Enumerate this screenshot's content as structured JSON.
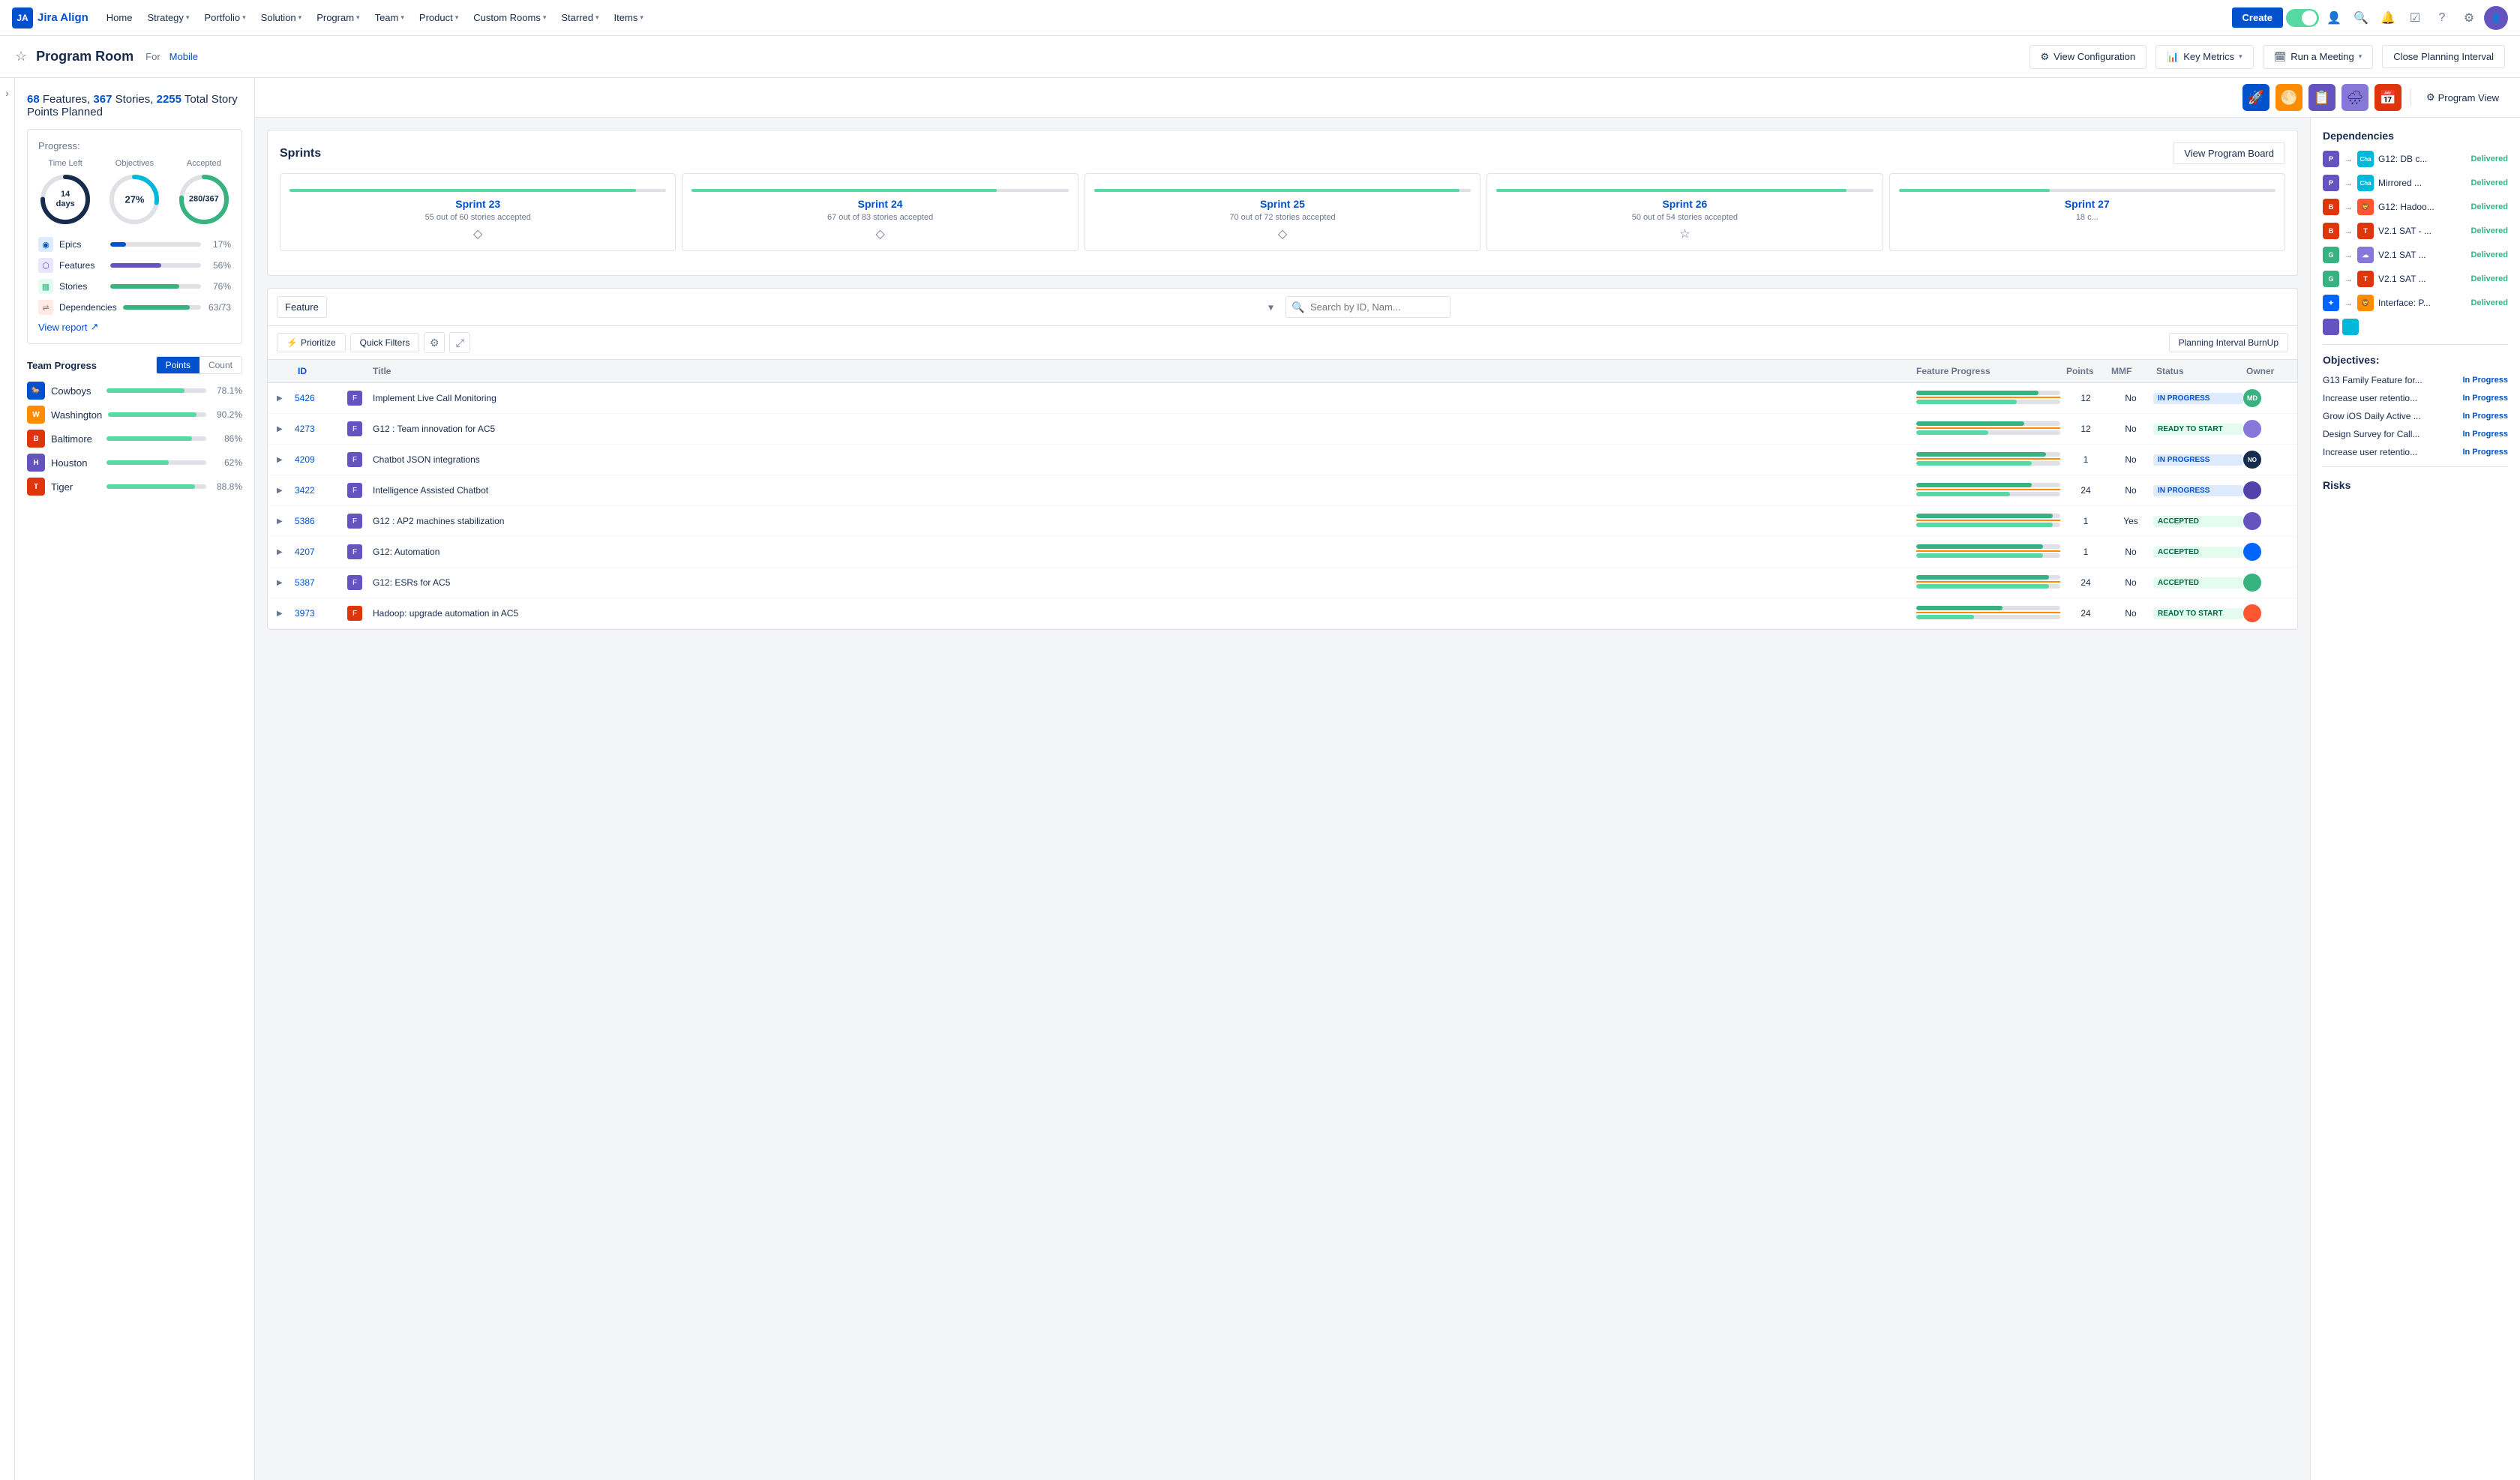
{
  "app": {
    "name": "Jira Align",
    "logo_text": "JA"
  },
  "nav": {
    "items": [
      {
        "label": "Home",
        "has_dropdown": false
      },
      {
        "label": "Strategy",
        "has_dropdown": true
      },
      {
        "label": "Portfolio",
        "has_dropdown": true
      },
      {
        "label": "Solution",
        "has_dropdown": true
      },
      {
        "label": "Program",
        "has_dropdown": true
      },
      {
        "label": "Team",
        "has_dropdown": true
      },
      {
        "label": "Product",
        "has_dropdown": true
      },
      {
        "label": "Custom Rooms",
        "has_dropdown": true
      },
      {
        "label": "Starred",
        "has_dropdown": true
      },
      {
        "label": "Items",
        "has_dropdown": true
      }
    ],
    "create_label": "Create"
  },
  "subheader": {
    "title": "Program Room",
    "for_label": "For",
    "room_name": "Mobile",
    "view_config_label": "View Configuration",
    "key_metrics_label": "Key Metrics",
    "run_meeting_label": "Run a Meeting",
    "close_interval_label": "Close Planning Interval",
    "program_view_label": "Program View"
  },
  "stats_header": {
    "features_count": "68",
    "stories_count": "367",
    "points_total": "2255",
    "label": "Features,",
    "label2": "Stories,",
    "label3": "Total Story Points Planned"
  },
  "progress": {
    "label": "Progress:",
    "time_left_label": "Time Left",
    "objectives_label": "Objectives",
    "accepted_label": "Accepted",
    "time_left_value": "14 days",
    "objectives_value": "27%",
    "objectives_pct": 27,
    "accepted_value": "280/367",
    "accepted_pct": 76,
    "bars": [
      {
        "icon": "◉",
        "icon_color": "#0052cc",
        "icon_bg": "#deebff",
        "label": "Epics",
        "pct": 17,
        "color": "#0052cc"
      },
      {
        "icon": "⬡",
        "icon_color": "#6554c0",
        "icon_bg": "#eae6ff",
        "label": "Features",
        "pct": 56,
        "color": "#6554c0"
      },
      {
        "icon": "▦",
        "icon_color": "#36b37e",
        "icon_bg": "#e3fcef",
        "label": "Stories",
        "pct": 76,
        "color": "#36b37e"
      },
      {
        "icon": "⇌",
        "icon_color": "#ff5630",
        "icon_bg": "#ffebe6",
        "label": "Dependencies",
        "pct": 86,
        "color": "#36b37e",
        "count": "63/73"
      }
    ],
    "view_report_label": "View report"
  },
  "team_progress": {
    "title": "Team Progress",
    "tabs": [
      "Points",
      "Count"
    ],
    "active_tab": "Points",
    "teams": [
      {
        "name": "Cowboys",
        "pct": 78.1,
        "pct_label": "78.1%",
        "color": "#0052cc",
        "icon_bg": "#0052cc",
        "icon_text": "🐎"
      },
      {
        "name": "Washington",
        "pct": 90.2,
        "pct_label": "90.2%",
        "color": "#36b37e",
        "icon_bg": "#ff8b00",
        "icon_text": "W"
      },
      {
        "name": "Baltimore",
        "pct": 86,
        "pct_label": "86%",
        "color": "#36b37e",
        "icon_bg": "#de350b",
        "icon_text": "B"
      },
      {
        "name": "Houston",
        "pct": 62,
        "pct_label": "62%",
        "color": "#36b37e",
        "icon_bg": "#6554c0",
        "icon_text": "H"
      },
      {
        "name": "Tiger",
        "pct": 88.8,
        "pct_label": "88.8%",
        "color": "#36b37e",
        "icon_bg": "#de350b",
        "icon_text": "T"
      }
    ]
  },
  "sprints": {
    "title": "Sprints",
    "view_board_label": "View Program Board",
    "items": [
      {
        "name": "Sprint 23",
        "stories": "55 out of 60 stories accepted",
        "pct": 92
      },
      {
        "name": "Sprint 24",
        "stories": "67 out of 83 stories accepted",
        "pct": 81
      },
      {
        "name": "Sprint 25",
        "stories": "70 out of 72 stories accepted",
        "pct": 97
      },
      {
        "name": "Sprint 26",
        "stories": "50 out of 54 stories accepted",
        "pct": 93
      },
      {
        "name": "Sprint 27",
        "stories": "18 c...",
        "pct": 40
      }
    ]
  },
  "feature_table": {
    "select_placeholder": "Feature",
    "search_placeholder": "Search by ID, Nam...",
    "prioritize_label": "Prioritize",
    "quick_filters_label": "Quick Filters",
    "burnup_label": "Planning Interval BurnUp",
    "columns": [
      "",
      "ID",
      "",
      "Title",
      "Feature Progress",
      "Points",
      "MMF",
      "Status",
      "Owner"
    ],
    "rows": [
      {
        "expand": "▶",
        "id": "5426",
        "icon_bg": "#6554c0",
        "icon_text": "F",
        "title": "Implement Live Call Monitoring",
        "progress": 85,
        "points": 12,
        "mmf": "No",
        "status": "IN PROGRESS",
        "status_class": "status-in-progress",
        "avatar_bg": "#36b37e",
        "avatar_text": "MD"
      },
      {
        "expand": "▶",
        "id": "4273",
        "icon_bg": "#6554c0",
        "icon_text": "F",
        "title": "G12 : Team innovation for AC5",
        "progress": 75,
        "points": 12,
        "mmf": "No",
        "status": "READY TO START",
        "status_class": "status-ready",
        "avatar_bg": "#8777d9",
        "avatar_text": ""
      },
      {
        "expand": "▶",
        "id": "4209",
        "icon_bg": "#6554c0",
        "icon_text": "F",
        "title": "Chatbot JSON integrations",
        "progress": 90,
        "points": 1,
        "mmf": "No",
        "status": "IN PROGRESS",
        "status_class": "status-in-progress",
        "avatar_bg": "#172b4d",
        "avatar_text": "NO"
      },
      {
        "expand": "▶",
        "id": "3422",
        "icon_bg": "#6554c0",
        "icon_text": "F",
        "title": "Intelligence Assisted Chatbot",
        "progress": 80,
        "points": 24,
        "mmf": "No",
        "status": "IN PROGRESS",
        "status_class": "status-in-progress",
        "avatar_bg": "#5243aa",
        "avatar_text": ""
      },
      {
        "expand": "▶",
        "id": "5386",
        "icon_bg": "#6554c0",
        "icon_text": "F",
        "title": "G12 : AP2 machines stabilization",
        "progress": 95,
        "points": 1,
        "mmf": "Yes",
        "status": "ACCEPTED",
        "status_class": "status-accepted",
        "avatar_bg": "#6554c0",
        "avatar_text": ""
      },
      {
        "expand": "▶",
        "id": "4207",
        "icon_bg": "#6554c0",
        "icon_text": "F",
        "title": "G12: Automation",
        "progress": 88,
        "points": 1,
        "mmf": "No",
        "status": "ACCEPTED",
        "status_class": "status-accepted",
        "avatar_bg": "#0065ff",
        "avatar_text": ""
      },
      {
        "expand": "▶",
        "id": "5387",
        "icon_bg": "#6554c0",
        "icon_text": "F",
        "title": "G12: ESRs for AC5",
        "progress": 92,
        "points": 24,
        "mmf": "No",
        "status": "ACCEPTED",
        "status_class": "status-accepted",
        "avatar_bg": "#36b37e",
        "avatar_text": ""
      },
      {
        "expand": "▶",
        "id": "3973",
        "icon_bg": "#de350b",
        "icon_text": "F",
        "title": "Hadoop: upgrade automation in AC5",
        "progress": 60,
        "points": 24,
        "mmf": "No",
        "status": "READY TO START",
        "status_class": "status-ready",
        "avatar_bg": "#ff5630",
        "avatar_text": ""
      }
    ]
  },
  "dependencies_panel": {
    "title": "Dependencies",
    "items": [
      {
        "from_bg": "#6554c0",
        "from_text": "P",
        "to_bg": "#00b8d9",
        "to_text": "Cha",
        "desc": "G12: DB c...",
        "status": "Delivered"
      },
      {
        "from_bg": "#6554c0",
        "from_text": "P",
        "to_bg": "#00b8d9",
        "to_text": "Cha",
        "desc": "Mirrored ...",
        "status": "Delivered"
      },
      {
        "from_bg": "#de350b",
        "from_text": "B",
        "to_bg": "#ff5630",
        "to_text": "🦁",
        "desc": "G12: Hadoo...",
        "status": "Delivered"
      },
      {
        "from_bg": "#de350b",
        "from_text": "B",
        "to_bg": "#de350b",
        "to_text": "T",
        "desc": "V2.1 SAT - ...",
        "status": "Delivered"
      },
      {
        "from_bg": "#36b37e",
        "from_text": "G",
        "to_bg": "#8777d9",
        "to_text": "☁",
        "desc": "V2.1 SAT ...",
        "status": "Delivered"
      },
      {
        "from_bg": "#36b37e",
        "from_text": "G",
        "to_bg": "#de350b",
        "to_text": "T",
        "desc": "V2.1 SAT ...",
        "status": "Delivered"
      },
      {
        "from_bg": "#0065ff",
        "from_text": "✦",
        "to_bg": "#ff8b00",
        "to_text": "🦁",
        "desc": "Interface: P...",
        "status": "Delivered"
      }
    ]
  },
  "objectives_panel": {
    "title": "Objectives:",
    "items": [
      {
        "text": "G13 Family Feature for...",
        "status": "In Progress"
      },
      {
        "text": "Increase user retentio...",
        "status": "In Progress"
      },
      {
        "text": "Grow iOS Daily Active ...",
        "status": "In Progress"
      },
      {
        "text": "Design Survey for Call...",
        "status": "In Progress"
      },
      {
        "text": "Increase user retentio...",
        "status": "In Progress"
      }
    ]
  },
  "risks_panel": {
    "title": "Risks"
  },
  "view_icons": [
    {
      "icon": "🚀",
      "bg": "#0052cc",
      "label": "rocket"
    },
    {
      "icon": "🌕",
      "bg": "#ff8b00",
      "label": "moon"
    },
    {
      "icon": "📋",
      "bg": "#6554c0",
      "label": "list"
    },
    {
      "icon": "🌧",
      "bg": "#8777d9",
      "label": "cloud"
    },
    {
      "icon": "📅",
      "bg": "#de350b",
      "label": "calendar"
    }
  ]
}
